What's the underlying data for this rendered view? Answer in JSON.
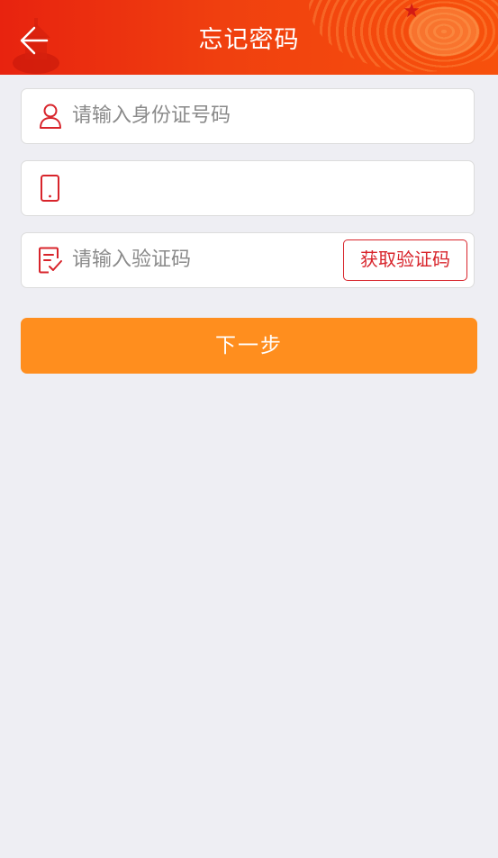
{
  "colors": {
    "header": "#ea2c10",
    "accent_red": "#d8242b",
    "primary_button": "#ff8e1e",
    "background": "#eeeef3"
  },
  "header": {
    "title": "忘记密码",
    "back_icon": "back-arrow-icon"
  },
  "form": {
    "id_field": {
      "icon": "user-icon",
      "value": "",
      "placeholder": "请输入身份证号码"
    },
    "phone_field": {
      "icon": "phone-icon",
      "value": "",
      "placeholder": ""
    },
    "code_field": {
      "icon": "edit-check-icon",
      "value": "",
      "placeholder": "请输入验证码",
      "get_code_label": "获取验证码"
    },
    "next_label": "下一步"
  }
}
